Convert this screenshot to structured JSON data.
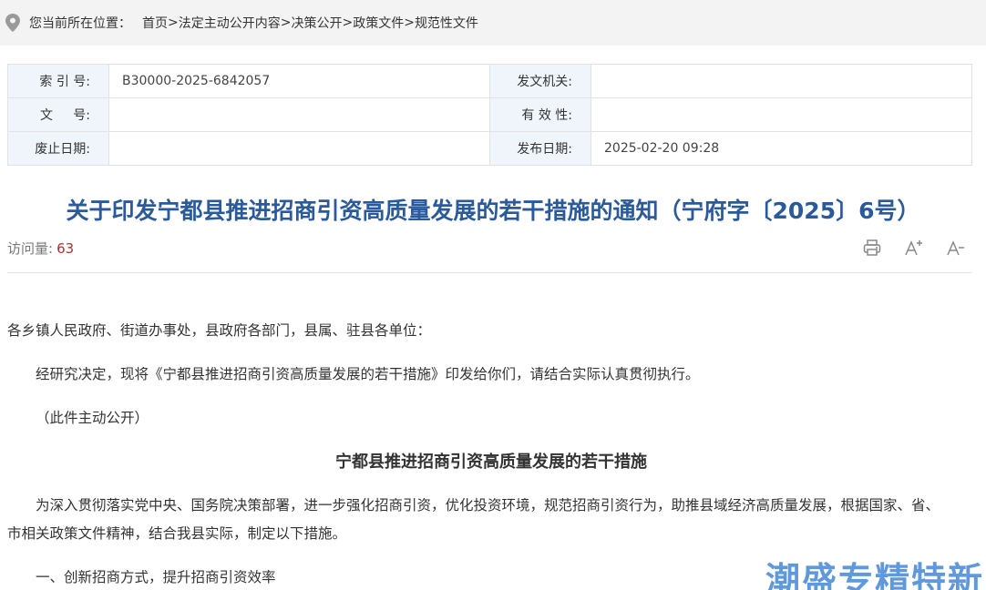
{
  "breadcrumb": {
    "prefix": "您当前所在位置：",
    "items": [
      "首页",
      "法定主动公开内容",
      "决策公开",
      "政策文件",
      "规范性文件"
    ],
    "separator": ">"
  },
  "meta": {
    "index_label": "索 引 号:",
    "index_value": "B30000-2025-6842057",
    "issuer_label": "发文机关:",
    "issuer_value": "",
    "docno_label": "文     号:",
    "docno_value": "",
    "validity_label": "有 效 性:",
    "validity_value": "",
    "expiry_label": "废止日期:",
    "expiry_value": "",
    "publish_label": "发布日期:",
    "publish_value": "2025-02-20 09:28"
  },
  "title": "关于印发宁都县推进招商引资高质量发展的若干措施的通知（宁府字〔2025〕6号）",
  "visits": {
    "label": "访问量:",
    "count": "63"
  },
  "tools": [
    "print-icon",
    "font-increase-icon",
    "font-decrease-icon"
  ],
  "body": {
    "greeting": "各乡镇人民政府、街道办事处，县政府各部门，县属、驻县各单位：",
    "p1": "经研究决定，现将《宁都县推进招商引资高质量发展的若干措施》印发给你们，请结合实际认真贯彻执行。",
    "p2": "（此件主动公开）",
    "subtitle": "宁都县推进招商引资高质量发展的若干措施",
    "p3_line1": "为深入贯彻落实党中央、国务院决策部署，进一步强化招商引资，优化投资环境，规范招商引资行为，助推县域经济高质量发展，根据国家、省、",
    "p3_line2": "市相关政策文件精神，结合我县实际，制定以下措施。",
    "p4": "一、创新招商方式，提升招商引资效率"
  },
  "watermark": "潮盛专精特新",
  "colors": {
    "title": "#2b5a9a",
    "label_bg": "#f0f5fb",
    "visits_num": "#aa3333",
    "watermark": "#4f8fd8"
  }
}
